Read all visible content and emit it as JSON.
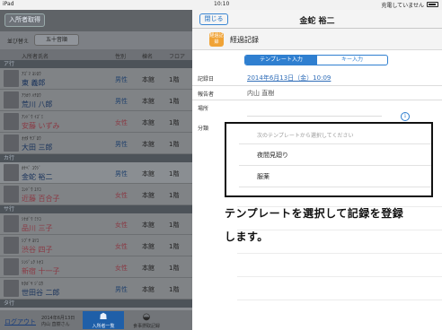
{
  "statusbar": {
    "device": "iPad",
    "time": "10:10",
    "battery": "充電していません"
  },
  "header": {
    "fetch_button": "入所者取得"
  },
  "sort": {
    "label": "並び替え",
    "button": "五十音順"
  },
  "list": {
    "columns": {
      "name": "入所者氏名",
      "gender": "性別",
      "building": "棟名",
      "floor": "フロア"
    },
    "groups": [
      {
        "label": "ア行",
        "rows": [
          {
            "kana": "ｱｽﾞﾏ ﾖｼﾛｳ",
            "name": "東 義郎",
            "gender": "男性",
            "building": "本館",
            "floor": "1階",
            "female": false
          },
          {
            "kana": "ｱﾗｶﾜ ﾊﾁﾛｳ",
            "name": "荒川 八郎",
            "gender": "男性",
            "building": "本館",
            "floor": "1階",
            "female": false
          },
          {
            "kana": "ｱﾝﾄﾞｳ ｲｽﾞﾐ",
            "name": "安藤 いずみ",
            "gender": "女性",
            "building": "本館",
            "floor": "1階",
            "female": true
          },
          {
            "kana": "ｵｵﾀ ｻﾌﾞﾛｳ",
            "name": "大田 三郎",
            "gender": "男性",
            "building": "本館",
            "floor": "1階",
            "female": false
          }
        ]
      },
      {
        "label": "カ行",
        "rows": [
          {
            "kana": "ｶﾅﾍﾞ ﾕｳｼﾞ",
            "name": "金蛇 裕二",
            "gender": "男性",
            "building": "本館",
            "floor": "1階",
            "female": false
          },
          {
            "kana": "ｺﾝﾄﾞｳ ﾕﾘｺ",
            "name": "近藤 百合子",
            "gender": "女性",
            "building": "本館",
            "floor": "1階",
            "female": true
          }
        ]
      },
      {
        "label": "サ行",
        "rows": [
          {
            "kana": "ｼﾅｶﾞﾜ ﾐﾂｺ",
            "name": "品川 三子",
            "gender": "女性",
            "building": "本館",
            "floor": "1階",
            "female": true
          },
          {
            "kana": "ｼﾌﾞﾔ ﾖﾂｺ",
            "name": "渋谷 四子",
            "gender": "女性",
            "building": "本館",
            "floor": "1階",
            "female": true
          },
          {
            "kana": "ｼﾝｼﾞｭｸ ﾄｵｺ",
            "name": "新宿 十一子",
            "gender": "女性",
            "building": "本館",
            "floor": "1階",
            "female": true
          },
          {
            "kana": "ｾﾀｶﾞﾔ ｼﾞﾛｳ",
            "name": "世田谷 二郎",
            "gender": "男性",
            "building": "本館",
            "floor": "1階",
            "female": false
          }
        ]
      },
      {
        "label": "タ行",
        "rows": []
      }
    ]
  },
  "tabbar": {
    "logout": "ログアウト",
    "date": "2014年6月13日",
    "user": "内山 直樹さん",
    "tabs": [
      {
        "label": "入所者一覧",
        "icon": "people-icon",
        "glyph": "☗"
      },
      {
        "label": "食事摂取記録",
        "icon": "bowl-icon",
        "glyph": "◒"
      }
    ]
  },
  "modal": {
    "close_button": "閉じる",
    "title": "金蛇 裕二",
    "app_icon_text": "経過記録",
    "subtitle": "経過記録",
    "segments": [
      "テンプレート入力",
      "キー入力"
    ],
    "fields": {
      "date_label": "記録日",
      "date_value": "2014年6月13日（金）10:09",
      "reporter_label": "報告者",
      "reporter_value": "内山 直樹",
      "place_label": "場所",
      "category_label": "分類"
    },
    "info_glyph": "i",
    "popup": {
      "hint": "次のテンプレートから選択してください",
      "items": [
        "夜間見廻り",
        "服薬"
      ]
    },
    "caption_lines": [
      "テンプレートを選択して記録を登録",
      "します。"
    ]
  }
}
